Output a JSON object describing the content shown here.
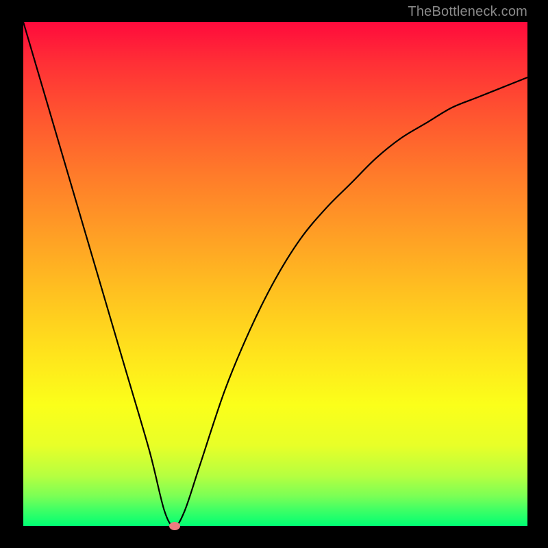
{
  "watermark": "TheBottleneck.com",
  "chart_data": {
    "type": "line",
    "title": "",
    "xlabel": "",
    "ylabel": "",
    "xlim": [
      0,
      100
    ],
    "ylim": [
      0,
      100
    ],
    "grid": false,
    "series": [
      {
        "name": "bottleneck-curve",
        "x": [
          0,
          5,
          10,
          15,
          20,
          25,
          28,
          30,
          32,
          35,
          40,
          45,
          50,
          55,
          60,
          65,
          70,
          75,
          80,
          85,
          90,
          95,
          100
        ],
        "values": [
          100,
          83,
          66,
          49,
          32,
          15,
          3,
          0,
          3,
          12,
          27,
          39,
          49,
          57,
          63,
          68,
          73,
          77,
          80,
          83,
          85,
          87,
          89
        ]
      }
    ],
    "marker": {
      "x": 30,
      "y": 0,
      "color": "#ef7c80"
    },
    "background_gradient": {
      "top": "#ff0a3c",
      "bottom": "#00ff73"
    }
  }
}
